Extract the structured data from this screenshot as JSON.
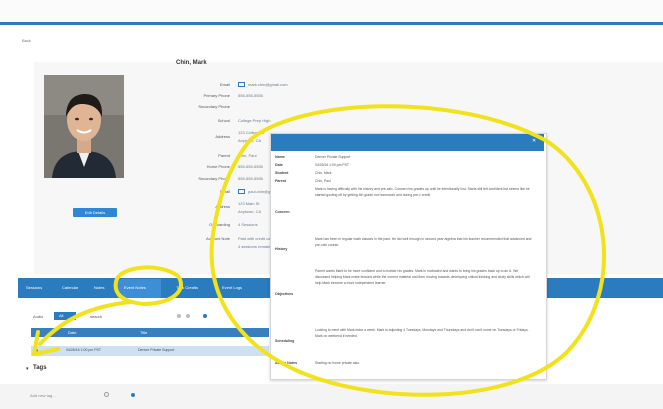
{
  "header": {
    "back_link": "Back"
  },
  "profile": {
    "name": "Chin, Mark",
    "fields": [
      {
        "label": "Email",
        "value": "mark.chin@gmail.com"
      },
      {
        "label": "Primary Phone",
        "value": "555-555-5555"
      },
      {
        "label": "Secondary Phone",
        "value": ""
      },
      {
        "label": "School",
        "value": "College Prep High"
      },
      {
        "label": "Address",
        "value": "123 College St"
      },
      {
        "label": "",
        "value": "Anytown, CA"
      },
      {
        "label": "Parent",
        "value": "Chin, Paul"
      },
      {
        "label": "Home Phone",
        "value": "555-555-5555"
      },
      {
        "label": "Secondary Phone",
        "value": "555-555-5555"
      },
      {
        "label": "Email",
        "value": "paul.chin@gmail.com"
      },
      {
        "label": "Address",
        "value": "123 Main St"
      },
      {
        "label": "",
        "value": "Anytown, CA"
      },
      {
        "label": "Onboarding",
        "value": "4 Sessions"
      },
      {
        "label": "Account Note",
        "value": "Paid with credit card"
      },
      {
        "label": "",
        "value": "4 sessions remaining"
      }
    ],
    "edit_button": "Edit Details"
  },
  "tabs": [
    "Sessions",
    "Calendar",
    "Notes",
    "Event Notes",
    "Task Credits",
    "Event Logs"
  ],
  "active_tab_index": 3,
  "subtoolbar": {
    "prefix": "Audio",
    "selected": "All",
    "search_label": "search"
  },
  "table": {
    "headers": [
      "Date",
      "Title"
    ],
    "rows": [
      {
        "date": "04/26/16 1:00 pm PST",
        "title": "Denver Private Support"
      }
    ]
  },
  "tags": {
    "title": "Tags",
    "add_placeholder": "Add new tag..."
  },
  "popup": {
    "close_glyph": "✕",
    "fields": [
      {
        "label": "Name",
        "value": "Denver Private Support"
      },
      {
        "label": "Date",
        "value": "04/26/16 1:00 pm PST"
      },
      {
        "label": "Student",
        "value": "Chin, Mark"
      },
      {
        "label": "Parent",
        "value": "Chin, Paul"
      },
      {
        "label": "Concern",
        "value": "Mark is having difficulty with his history and pre-calc. Concern his grades up until he intentionally lost. Starts still felt confident but seems like he started goofing off by getting 4th grade not homework and during pre-c credit."
      },
      {
        "label": "History",
        "value": "Mark has been in regular math classes in the past. He did well enough in second year algebra that his teacher recommended that advanced and pre-calc course."
      },
      {
        "label": "Objectives",
        "value": "Parent wants Mark to be more confident and to bolster his grades. Mark is motivated and wants to bring his grades back up to an A. We discussed helping Mark make lessons while the current material and then moving towards developing critical thinking and study skills which will help Mark become a more independent learner."
      },
      {
        "label": "Scheduling",
        "value": "Looking to meet with Mark twice a week. Mark is adjusting 4 Tuesdays, Mondays and Thursdays and don't can't come on Tuesdays or Fridays. Mark on weekend if needed."
      },
      {
        "label": "Admin Notes",
        "value": "Starting no home private also."
      }
    ]
  },
  "annotations": {
    "highlight_color": "#f2e21c"
  },
  "colors": {
    "accent": "#2b7bbf",
    "row_highlight": "#cfe0f0"
  }
}
